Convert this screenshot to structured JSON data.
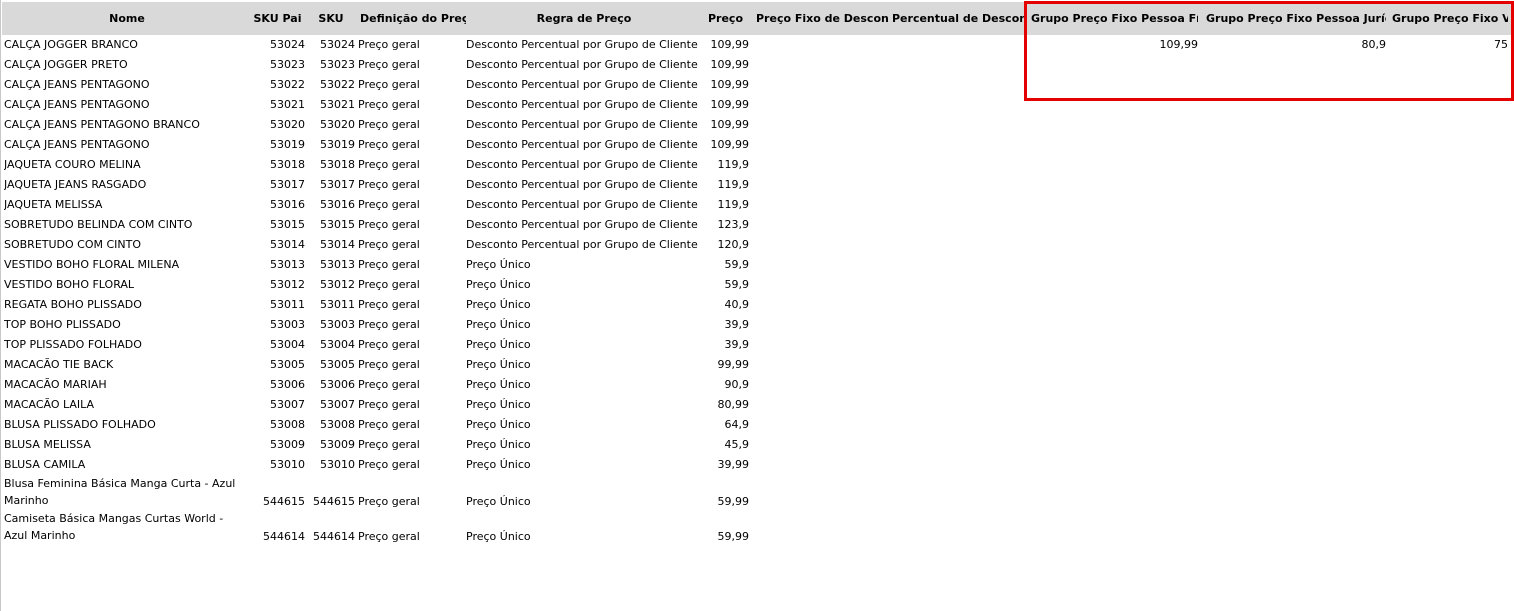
{
  "headers": {
    "name": "Nome",
    "sku_pai": "SKU Pai",
    "sku": "SKU",
    "definicao": "Definição do Preço",
    "regra": "Regra de Preço",
    "preco": "Preço",
    "preco_fixo_desconto": "Preço Fixo de Desconto",
    "percentual_desconto": "Percentual de Desconto",
    "grupo_pf": "Grupo Preço Fixo Pessoa Física",
    "grupo_pj": "Grupo Preço Fixo Pessoa Jurídica",
    "grupo_vip": "Grupo Preço Fixo VIP"
  },
  "rows": [
    {
      "name": "CALÇA JOGGER BRANCO",
      "sku_pai": "53024",
      "sku": "53024",
      "def": "Preço geral",
      "regra": "Desconto Percentual por Grupo de Cliente",
      "preco": "109,99",
      "gpf": "109,99",
      "gpj": "80,9",
      "vip": "75"
    },
    {
      "name": "CALÇA JOGGER PRETO",
      "sku_pai": "53023",
      "sku": "53023",
      "def": "Preço geral",
      "regra": "Desconto Percentual por Grupo de Cliente",
      "preco": "109,99"
    },
    {
      "name": "CALÇA JEANS PENTAGONO",
      "sku_pai": "53022",
      "sku": "53022",
      "def": "Preço geral",
      "regra": "Desconto Percentual por Grupo de Cliente",
      "preco": "109,99"
    },
    {
      "name": "CALÇA JEANS PENTAGONO",
      "sku_pai": "53021",
      "sku": "53021",
      "def": "Preço geral",
      "regra": "Desconto Percentual por Grupo de Cliente",
      "preco": "109,99"
    },
    {
      "name": "CALÇA JEANS PENTAGONO BRANCO",
      "sku_pai": "53020",
      "sku": "53020",
      "def": "Preço geral",
      "regra": "Desconto Percentual por Grupo de Cliente",
      "preco": "109,99"
    },
    {
      "name": "CALÇA JEANS PENTAGONO",
      "sku_pai": "53019",
      "sku": "53019",
      "def": "Preço geral",
      "regra": "Desconto Percentual por Grupo de Cliente",
      "preco": "109,99"
    },
    {
      "name": "JAQUETA COURO MELINA",
      "sku_pai": "53018",
      "sku": "53018",
      "def": "Preço geral",
      "regra": "Desconto Percentual por Grupo de Cliente",
      "preco": "119,9"
    },
    {
      "name": "JAQUETA JEANS RASGADO",
      "sku_pai": "53017",
      "sku": "53017",
      "def": "Preço geral",
      "regra": "Desconto Percentual por Grupo de Cliente",
      "preco": "119,9"
    },
    {
      "name": "JAQUETA MELISSA",
      "sku_pai": "53016",
      "sku": "53016",
      "def": "Preço geral",
      "regra": "Desconto Percentual por Grupo de Cliente",
      "preco": "119,9"
    },
    {
      "name": "SOBRETUDO BELINDA COM CINTO",
      "sku_pai": "53015",
      "sku": "53015",
      "def": "Preço geral",
      "regra": "Desconto Percentual por Grupo de Cliente",
      "preco": "123,9"
    },
    {
      "name": "SOBRETUDO COM CINTO",
      "sku_pai": "53014",
      "sku": "53014",
      "def": "Preço geral",
      "regra": "Desconto Percentual por Grupo de Cliente",
      "preco": "120,9"
    },
    {
      "name": "VESTIDO BOHO FLORAL MILENA",
      "sku_pai": "53013",
      "sku": "53013",
      "def": "Preço geral",
      "regra": "Preço Único",
      "preco": "59,9"
    },
    {
      "name": "VESTIDO BOHO FLORAL",
      "sku_pai": "53012",
      "sku": "53012",
      "def": "Preço geral",
      "regra": "Preço Único",
      "preco": "59,9"
    },
    {
      "name": "REGATA BOHO PLISSADO",
      "sku_pai": "53011",
      "sku": "53011",
      "def": "Preço geral",
      "regra": "Preço Único",
      "preco": "40,9"
    },
    {
      "name": "TOP BOHO PLISSADO",
      "sku_pai": "53003",
      "sku": "53003",
      "def": "Preço geral",
      "regra": "Preço Único",
      "preco": "39,9"
    },
    {
      "name": "TOP PLISSADO FOLHADO",
      "sku_pai": "53004",
      "sku": "53004",
      "def": "Preço geral",
      "regra": "Preço Único",
      "preco": "39,9"
    },
    {
      "name": "MACACÃO TIE BACK",
      "sku_pai": "53005",
      "sku": "53005",
      "def": "Preço geral",
      "regra": "Preço Único",
      "preco": "99,99"
    },
    {
      "name": "MACACÃO MARIAH",
      "sku_pai": "53006",
      "sku": "53006",
      "def": "Preço geral",
      "regra": "Preço Único",
      "preco": "90,9"
    },
    {
      "name": "MACACÃO LAILA",
      "sku_pai": "53007",
      "sku": "53007",
      "def": "Preço geral",
      "regra": "Preço Único",
      "preco": "80,99"
    },
    {
      "name": "BLUSA PLISSADO FOLHADO",
      "sku_pai": "53008",
      "sku": "53008",
      "def": "Preço geral",
      "regra": "Preço Único",
      "preco": "64,9"
    },
    {
      "name": "BLUSA MELISSA",
      "sku_pai": "53009",
      "sku": "53009",
      "def": "Preço geral",
      "regra": "Preço Único",
      "preco": "45,9"
    },
    {
      "name": "BLUSA CAMILA",
      "sku_pai": "53010",
      "sku": "53010",
      "def": "Preço geral",
      "regra": "Preço Único",
      "preco": "39,99"
    },
    {
      "name": "Blusa Feminina Básica Manga Curta - Azul Marinho",
      "sku_pai": "544615",
      "sku": "544615",
      "def": "Preço geral",
      "regra": "Preço Único",
      "preco": "59,99",
      "tall": true
    },
    {
      "name": "Camiseta Básica Mangas Curtas World - Azul Marinho",
      "sku_pai": "544614",
      "sku": "544614",
      "def": "Preço geral",
      "regra": "Preço Único",
      "preco": "59,99",
      "tall": true
    }
  ],
  "highlight_color": "#e50000"
}
